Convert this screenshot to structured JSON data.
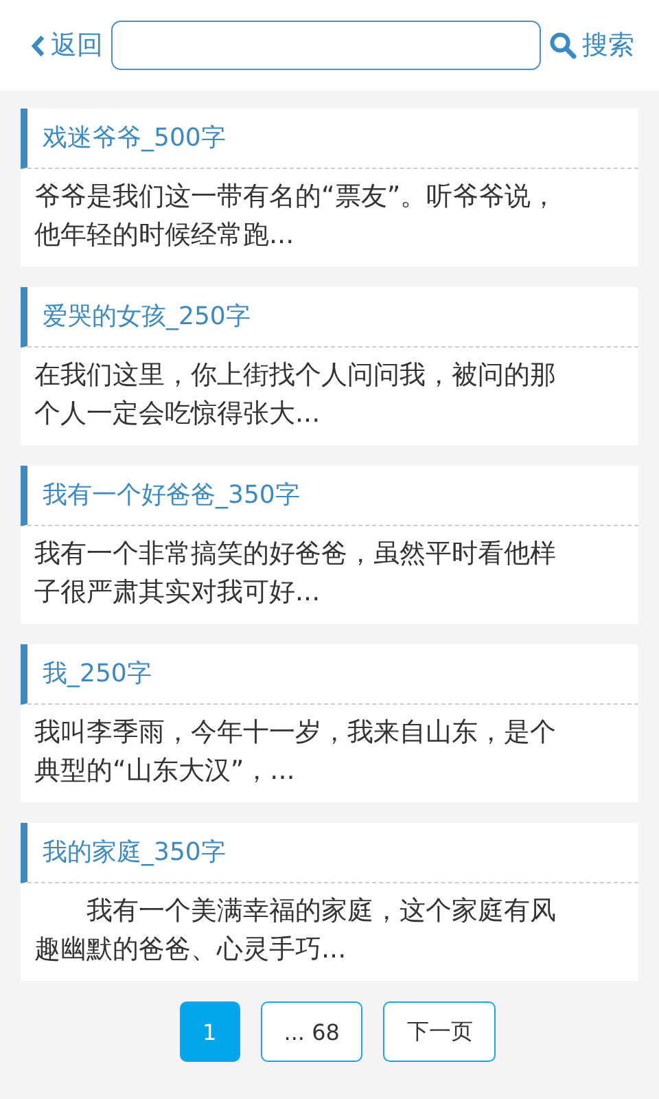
{
  "header": {
    "back": "返回",
    "search_button": "搜索"
  },
  "stories": [
    {
      "title": "戏迷爷爷_500字",
      "excerpt": "爷爷是我们这一带有名的“票友”。听爷爷说，他年轻的时候经常跑..."
    },
    {
      "title": "爱哭的女孩_250字",
      "excerpt": "在我们这里，你上街找个人问问我，被问的那个人一定会吃惊得张大..."
    },
    {
      "title": "我有一个好爸爸_350字",
      "excerpt": "我有一个非常搞笑的好爸爸，虽然平时看他样子很严肃其实对我可好..."
    },
    {
      "title": "我_250字",
      "excerpt": "我叫李季雨，今年十一岁，我来自山东，是个典型的“山东大汉”，..."
    },
    {
      "title": "我的家庭_350字",
      "excerpt": "　　我有一个美满幸福的家庭，这个家庭有风趣幽默的爸爸、心灵手巧..."
    }
  ],
  "pager": [
    {
      "label": "1",
      "selected": true
    },
    {
      "label": "... 68",
      "selected": false
    },
    {
      "label": "下一页",
      "selected": false
    }
  ]
}
